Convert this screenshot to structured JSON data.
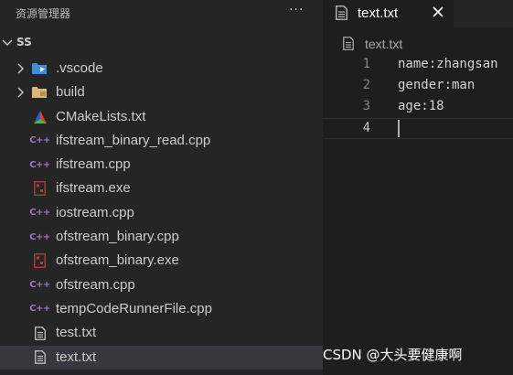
{
  "explorer": {
    "title": "资源管理器",
    "more_label": "···",
    "root_label": "SS",
    "items": [
      {
        "label": ".vscode",
        "type": "folder",
        "icon": "vscode-folder-icon"
      },
      {
        "label": "build",
        "type": "folder",
        "icon": "folder-icon"
      },
      {
        "label": "CMakeLists.txt",
        "type": "file",
        "icon": "cmake-icon"
      },
      {
        "label": "ifstream_binary_read.cpp",
        "type": "file",
        "icon": "cpp-file-icon"
      },
      {
        "label": "ifstream.cpp",
        "type": "file",
        "icon": "cpp-file-icon"
      },
      {
        "label": "ifstream.exe",
        "type": "file",
        "icon": "exe-file-icon"
      },
      {
        "label": "iostream.cpp",
        "type": "file",
        "icon": "cpp-file-icon"
      },
      {
        "label": "ofstream_binary.cpp",
        "type": "file",
        "icon": "cpp-file-icon"
      },
      {
        "label": "ofstream_binary.exe",
        "type": "file",
        "icon": "exe-file-icon"
      },
      {
        "label": "ofstream.cpp",
        "type": "file",
        "icon": "cpp-file-icon"
      },
      {
        "label": "tempCodeRunnerFile.cpp",
        "type": "file",
        "icon": "cpp-file-icon"
      },
      {
        "label": "test.txt",
        "type": "file",
        "icon": "text-file-icon"
      },
      {
        "label": "text.txt",
        "type": "file",
        "icon": "text-file-icon",
        "selected": true
      }
    ]
  },
  "editor": {
    "tab_label": "text.txt",
    "breadcrumb": "text.txt",
    "lines": [
      {
        "number": "1",
        "text": "name:zhangsan"
      },
      {
        "number": "2",
        "text": "gender:man"
      },
      {
        "number": "3",
        "text": "age:18"
      },
      {
        "number": "4",
        "text": ""
      }
    ],
    "active_line": 4
  },
  "watermark": "CSDN @大头要健康啊",
  "colors": {
    "sidebar_bg": "#252526",
    "editor_bg": "#1e1e1e",
    "selected_row": "#37373d",
    "cpp_icon": "#a074c4",
    "exe_icon": "#b0413e",
    "folder": "#dcb67a",
    "vscode_blue": "#3c8fd6"
  }
}
